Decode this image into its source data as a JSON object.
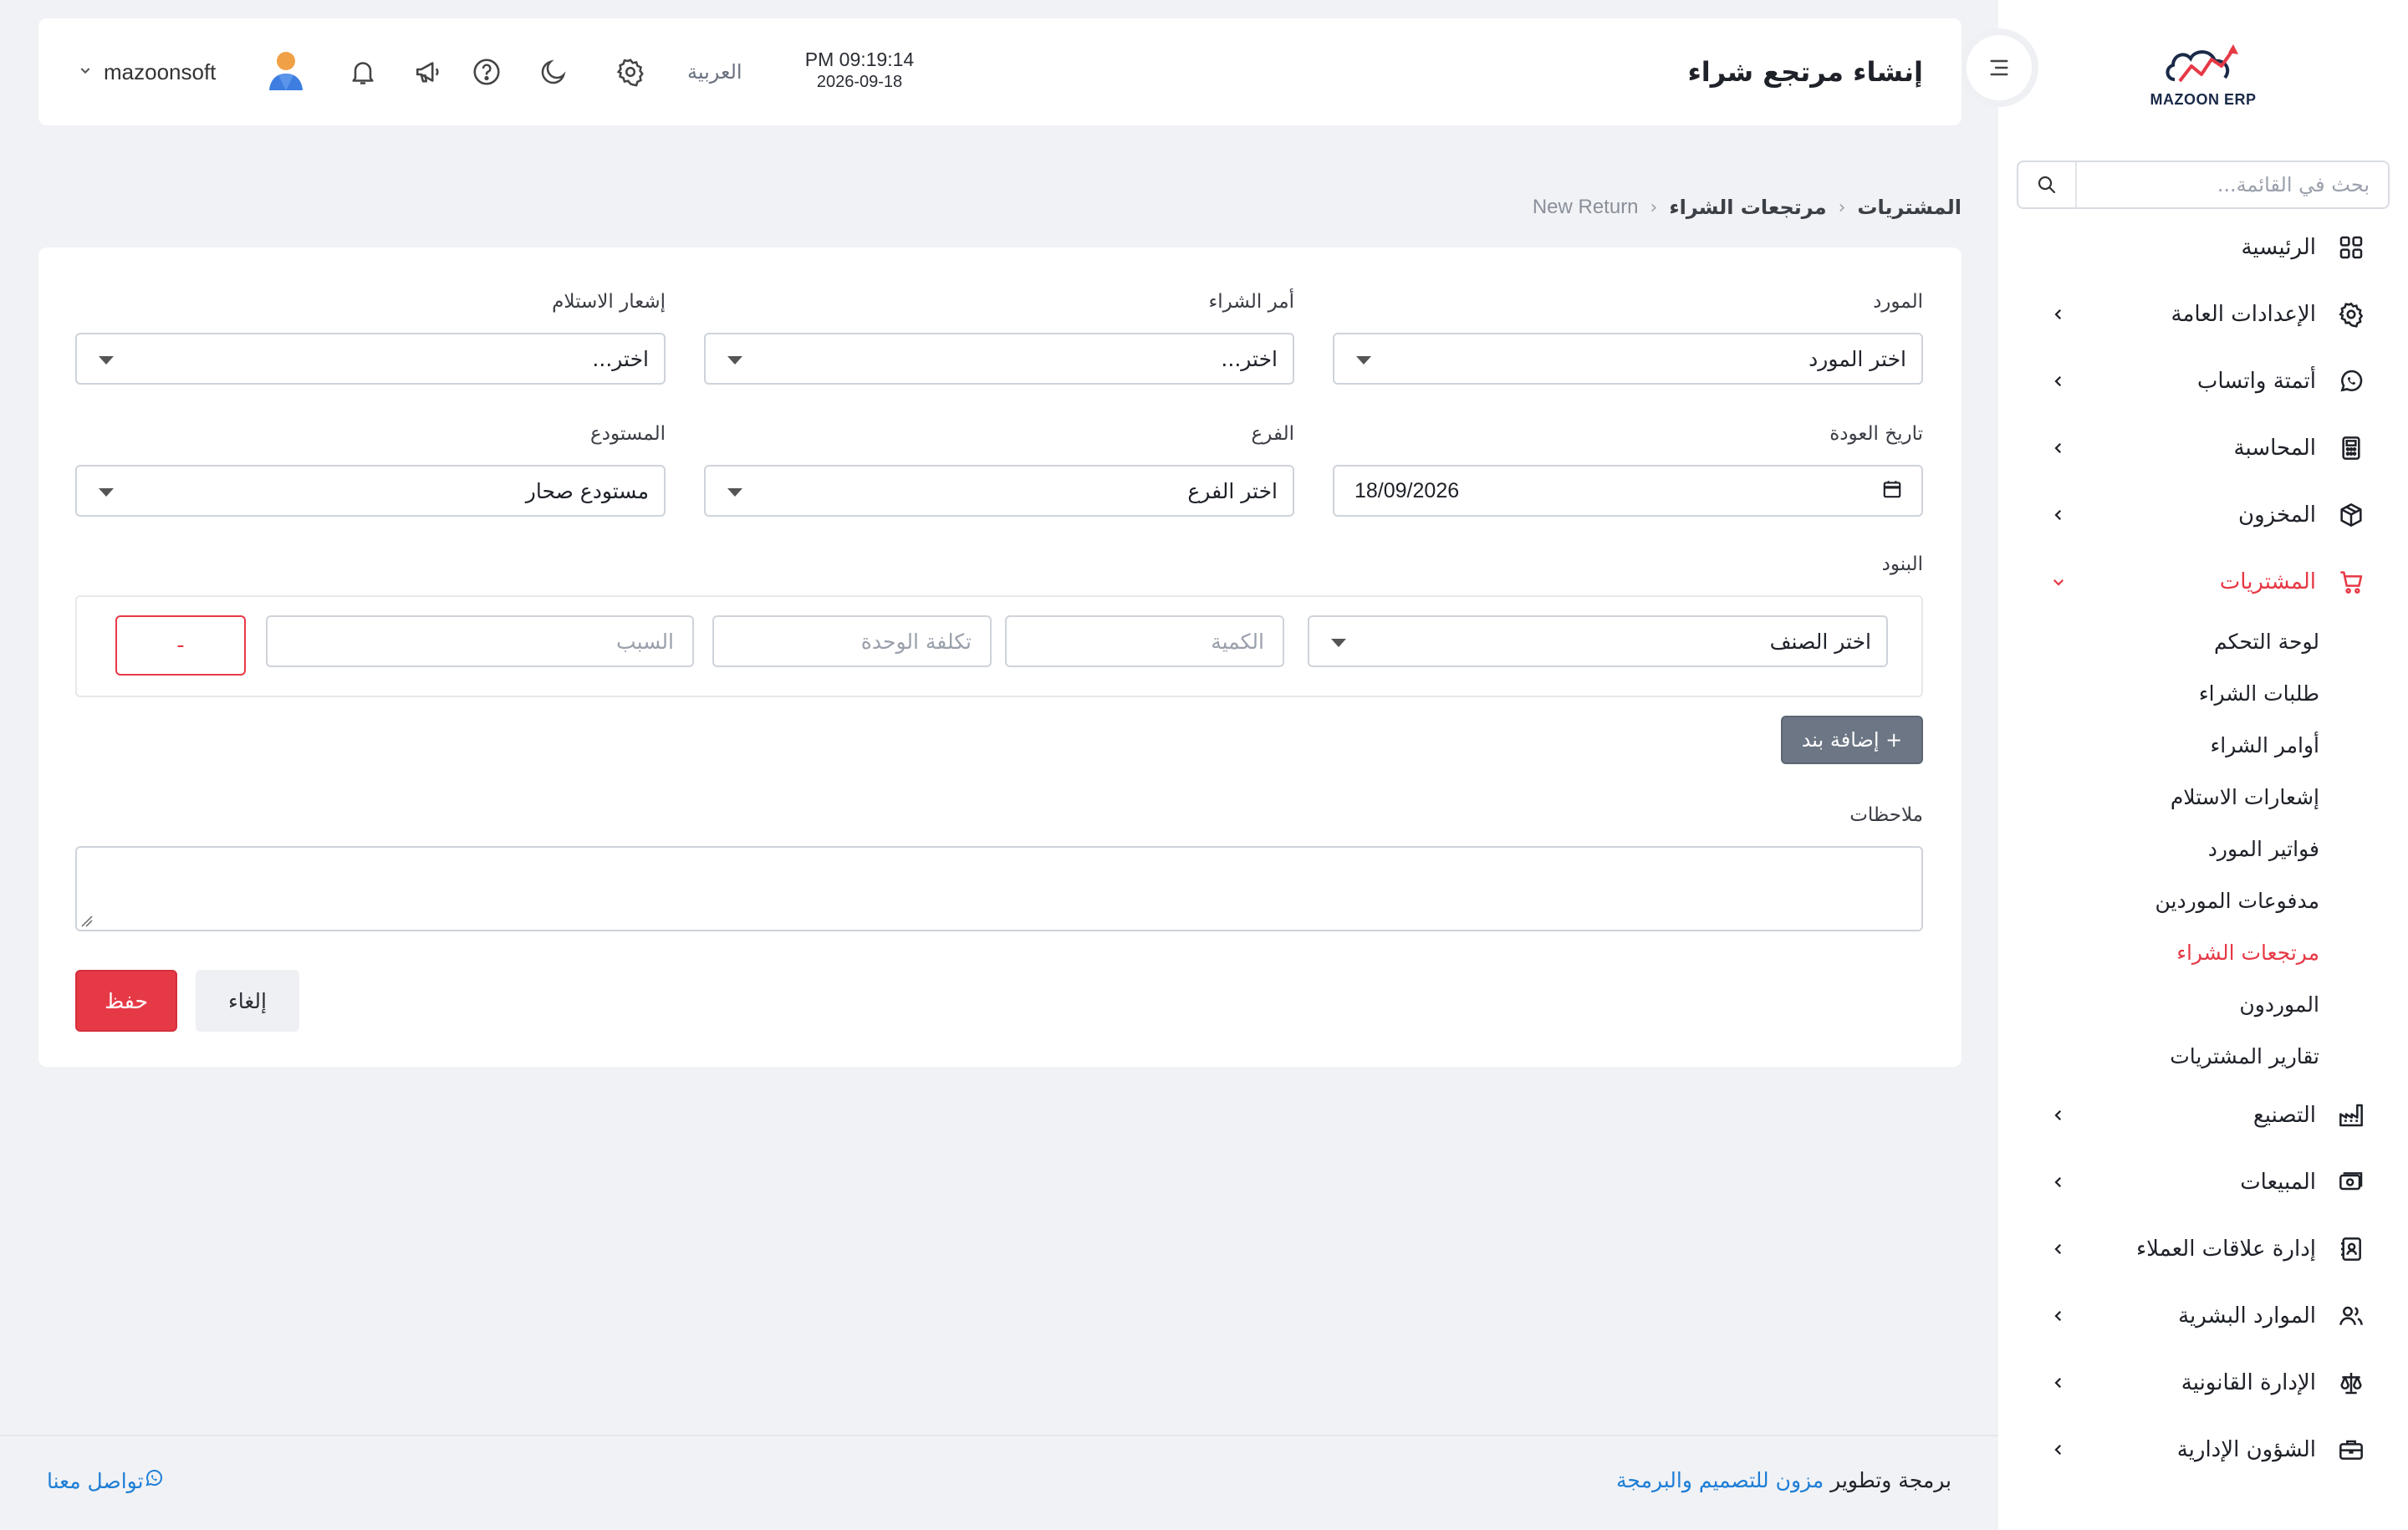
{
  "app": {
    "logo_text": "MAZOON ERP"
  },
  "header": {
    "title": "إنشاء مرتجع شراء",
    "time": "PM 09:19:14",
    "date": "2026-09-18",
    "language": "العربية",
    "username": "mazoonsoft"
  },
  "sidebar": {
    "search_placeholder": "بحث في القائمة...",
    "items": [
      {
        "label": "الرئيسية",
        "icon": "grid-icon"
      },
      {
        "label": "الإعدادات العامة",
        "icon": "gear-icon"
      },
      {
        "label": "أتمتة واتساب",
        "icon": "whatsapp-icon"
      },
      {
        "label": "المحاسبة",
        "icon": "calculator-icon"
      },
      {
        "label": "المخزون",
        "icon": "box-icon"
      },
      {
        "label": "المشتريات",
        "icon": "cart-icon"
      },
      {
        "label": "التصنيع",
        "icon": "factory-icon"
      },
      {
        "label": "المبيعات",
        "icon": "cash-icon"
      },
      {
        "label": "إدارة علاقات العملاء",
        "icon": "contacts-icon"
      },
      {
        "label": "الموارد البشرية",
        "icon": "users-icon"
      },
      {
        "label": "الإدارة القانونية",
        "icon": "scale-icon"
      },
      {
        "label": "الشؤون الإدارية",
        "icon": "briefcase-icon"
      }
    ],
    "purchases_sub": [
      {
        "label": "لوحة التحكم"
      },
      {
        "label": "طلبات الشراء"
      },
      {
        "label": "أوامر الشراء"
      },
      {
        "label": "إشعارات الاستلام"
      },
      {
        "label": "فواتير المورد"
      },
      {
        "label": "مدفوعات الموردين"
      },
      {
        "label": "مرتجعات الشراء"
      },
      {
        "label": "الموردون"
      },
      {
        "label": "تقارير المشتريات"
      }
    ]
  },
  "breadcrumb": {
    "level1": "المشتريات",
    "level2": "مرتجعات الشراء",
    "level3": "New Return"
  },
  "form": {
    "supplier_label": "المورد",
    "supplier_value": "اختر المورد",
    "po_label": "أمر الشراء",
    "po_value": "اختر...",
    "receipt_label": "إشعار الاستلام",
    "receipt_value": "اختر...",
    "return_date_label": "تاريخ العودة",
    "return_date_value": "18/09/2026",
    "branch_label": "الفرع",
    "branch_value": "اختر الفرع",
    "warehouse_label": "المستودع",
    "warehouse_value": "مستودع صحار",
    "items_label": "البنود",
    "item_select": "اختر الصنف",
    "qty_placeholder": "الكمية",
    "unit_cost_placeholder": "تكلفة الوحدة",
    "reason_placeholder": "السبب",
    "remove_label": "-",
    "add_item_label": "+ إضافة بند",
    "notes_label": "ملاحظات",
    "notes_value": "",
    "save_label": "حفظ",
    "cancel_label": "إلغاء"
  },
  "footer": {
    "credit_prefix": "برمجة وتطوير",
    "credit_link": "مزون للتصميم والبرمجة",
    "contact": "تواصل معنا"
  },
  "colors": {
    "accent": "#e63946",
    "link": "#1d7ed6",
    "secondary_button": "#6c7684",
    "background": "#f1f2f5"
  }
}
